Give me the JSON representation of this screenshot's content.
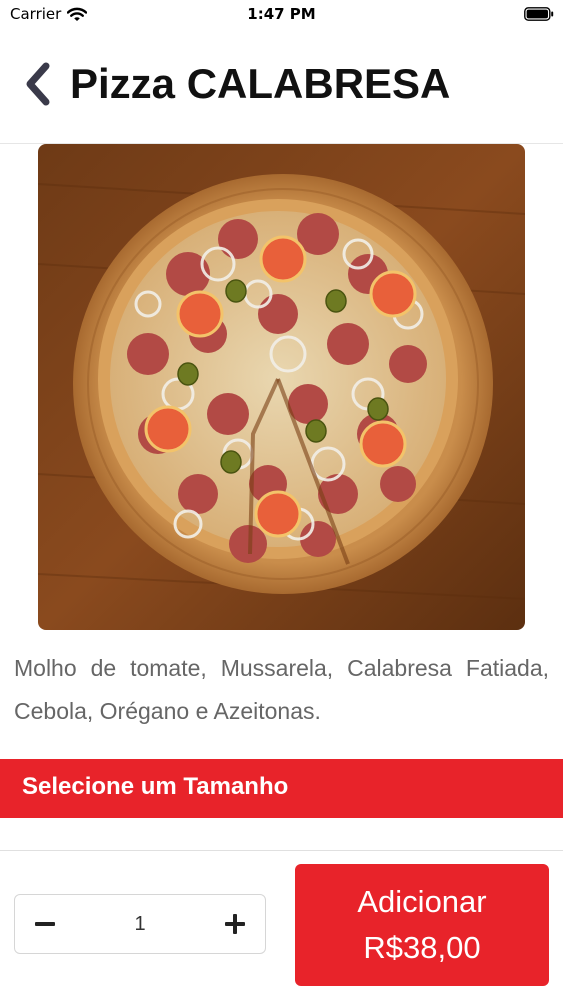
{
  "status": {
    "carrier": "Carrier",
    "time": "1:47 PM",
    "icons": [
      "wifi-icon",
      "battery-icon"
    ]
  },
  "header": {
    "title": "Pizza CALABRESA",
    "back_icon": "chevron-left-icon"
  },
  "product": {
    "image": "pizza-photo",
    "description": "Molho de tomate, Mussarela, Calabresa Fatiada, Cebola, Orégano e Azeitonas."
  },
  "size_section": {
    "label": "Selecione um Tamanho"
  },
  "cart": {
    "quantity": "1",
    "minus_icon": "minus-icon",
    "plus_icon": "plus-icon",
    "add_label": "Adicionar",
    "price": "R$38,00"
  },
  "colors": {
    "accent": "#e8232a",
    "text_muted": "#666666",
    "icon_dark": "#3a3a4a"
  }
}
